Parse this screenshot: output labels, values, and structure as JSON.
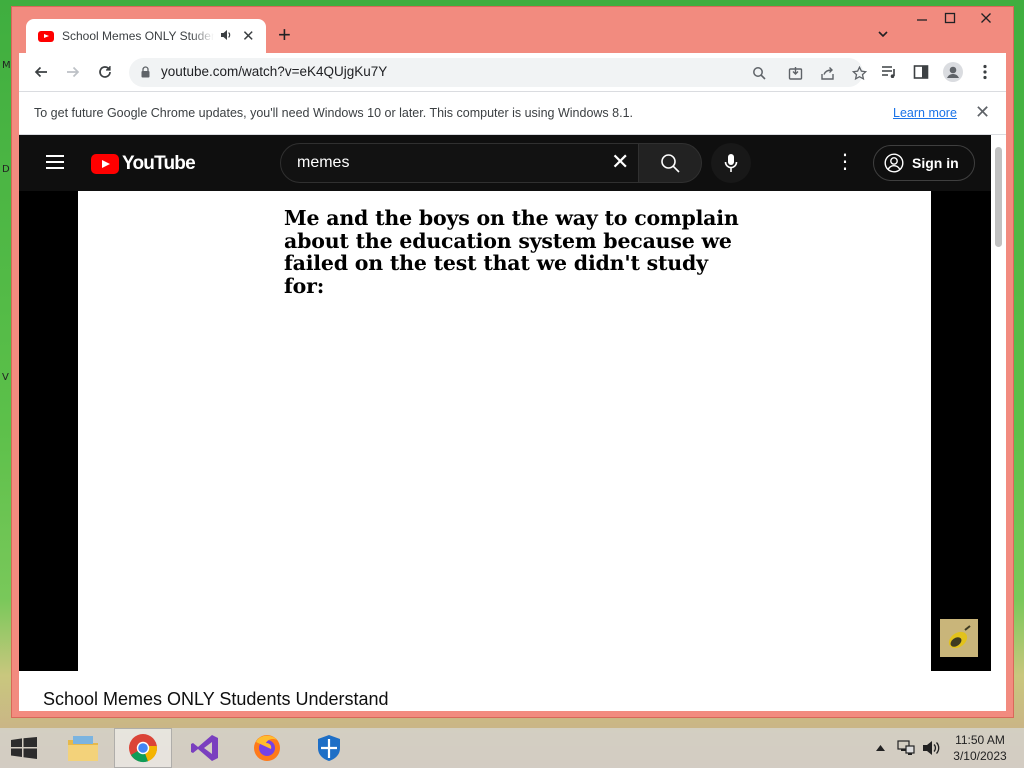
{
  "desktop": {
    "edge_glyphs": [
      "M",
      "D",
      "V"
    ]
  },
  "browser": {
    "tab": {
      "title": "School Memes ONLY Students Understand - YouTube",
      "audio_icon": "speaker-icon",
      "close_glyph": "✕"
    },
    "new_tab_glyph": "+",
    "window_controls": {
      "minimize": "—",
      "maximize": "☐",
      "close": "✕"
    },
    "url": "youtube.com/watch?v=eK4QUjgKu7Y",
    "infobar": {
      "message": "To get future Google Chrome updates, you'll need Windows 10 or later. This computer is using Windows 8.1.",
      "link": "Learn more",
      "close_glyph": "✕"
    }
  },
  "youtube": {
    "logo_text": "YouTube",
    "search": {
      "value": "memes",
      "clear_glyph": "✕"
    },
    "more_glyph": "⋮",
    "sign_in_label": "Sign in",
    "video": {
      "caption": "Me and the boys on the way to complain about the education system because we failed on the test that we didn't study for:",
      "title": "School Memes ONLY Students Understand"
    }
  },
  "taskbar": {
    "apps": [
      "file-explorer-icon",
      "chrome-icon",
      "visual-studio-icon",
      "firefox-icon",
      "windows-defender-icon"
    ],
    "active_app": "chrome-icon",
    "clock": {
      "time": "11:50 AM",
      "date": "3/10/2023"
    }
  },
  "colors": {
    "window_frame": "#f28b7f",
    "youtube_red": "#ff0000",
    "youtube_header": "#0f0f0f",
    "link_blue": "#1a73e8"
  }
}
